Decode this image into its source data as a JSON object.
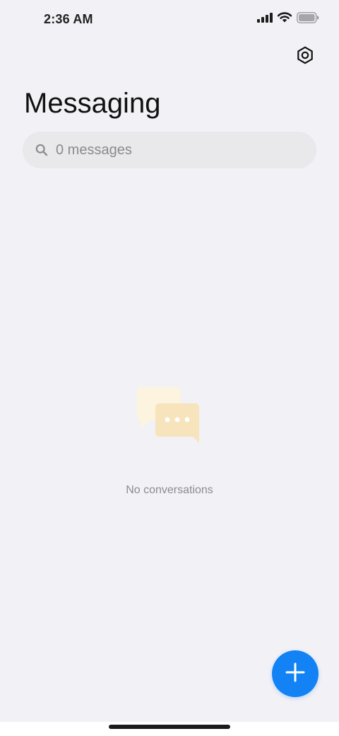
{
  "status_bar": {
    "time": "2:36 AM",
    "icons": [
      "signal-icon",
      "wifi-icon",
      "battery-icon"
    ]
  },
  "header": {
    "settings_icon": "settings-hex-icon",
    "title": "Messaging"
  },
  "search": {
    "icon": "search-icon",
    "placeholder": "0 messages"
  },
  "empty_state": {
    "illustration": "chat-bubbles-icon",
    "text": "No conversations"
  },
  "fab": {
    "icon": "plus-icon",
    "color": "#1282f4"
  },
  "colors": {
    "background": "#f2f1f6",
    "search_background": "#e9e9ec",
    "accent": "#1282f4",
    "muted_text": "#8b8b90"
  }
}
